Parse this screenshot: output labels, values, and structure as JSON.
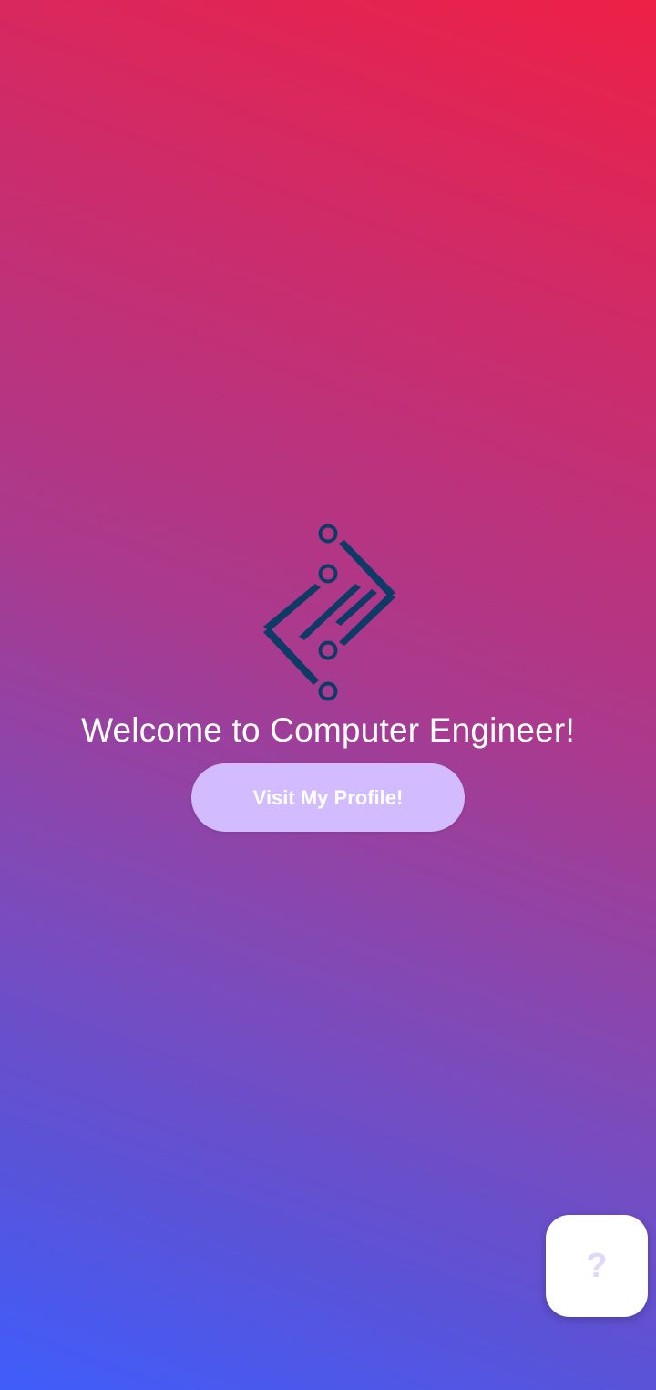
{
  "app": {
    "logo_icon": "circuit-diamond-logo-icon",
    "logo_color": "#0d3b66",
    "welcome_text": "Welcome to Computer Engineer!",
    "profile_button_label": "Visit My Profile!",
    "profile_button_color": "#d2bcff",
    "help_button_glyph": "?",
    "help_button_icon": "help-question-icon"
  },
  "theme": {
    "gradient_top": "#ee2046",
    "gradient_bottom": "#3f5dfb",
    "text_color": "#ffffff"
  }
}
